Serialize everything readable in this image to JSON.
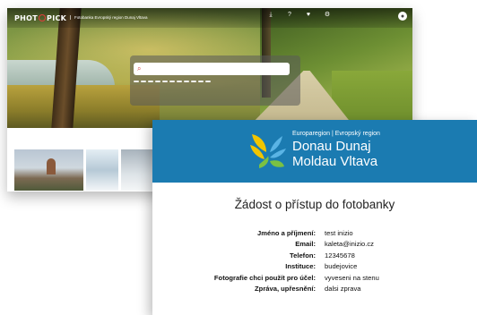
{
  "site": {
    "logo": {
      "left": "PHOT",
      "right": "PICK"
    },
    "tagline": "Fotobanka Evropský region Dunaj Vltava",
    "nav": [
      {
        "icon": "download-icon",
        "glyph": "⤓",
        "label": ""
      },
      {
        "icon": "help-icon",
        "glyph": "?",
        "label": ""
      },
      {
        "icon": "heart-icon",
        "glyph": "♥",
        "label": ""
      },
      {
        "icon": "gear-icon",
        "glyph": "⚙",
        "label": ""
      }
    ],
    "user": {
      "name": "",
      "subtitle": ""
    },
    "search": {
      "placeholder": ""
    },
    "tags": [
      "",
      "",
      "",
      "",
      "",
      "",
      "",
      "",
      "",
      "",
      ""
    ]
  },
  "document": {
    "region_subtitle": "Europaregion | Evropský region",
    "region_title_line1": "Donau Dunaj",
    "region_title_line2": "Moldau Vltava",
    "title": "Žádost o přístup do fotobanky",
    "fields": [
      {
        "label": "Jméno a příjmení:",
        "value": "test inizio"
      },
      {
        "label": "Email:",
        "value": "kaleta@inizio.cz"
      },
      {
        "label": "Telefon:",
        "value": "12345678"
      },
      {
        "label": "Instituce:",
        "value": "budejovice"
      },
      {
        "label": "Fotografie chci použít pro účel:",
        "value": "vyveseni na stenu"
      },
      {
        "label": "Zpráva, upřesnění:",
        "value": "dalsi zprava"
      }
    ]
  },
  "colors": {
    "header_blue": "#1b7bb1",
    "emblem_yellow": "#f2c500",
    "emblem_green": "#7ac143",
    "emblem_lightblue": "#5ab4e5",
    "logo_accent": "#e23b3b"
  }
}
